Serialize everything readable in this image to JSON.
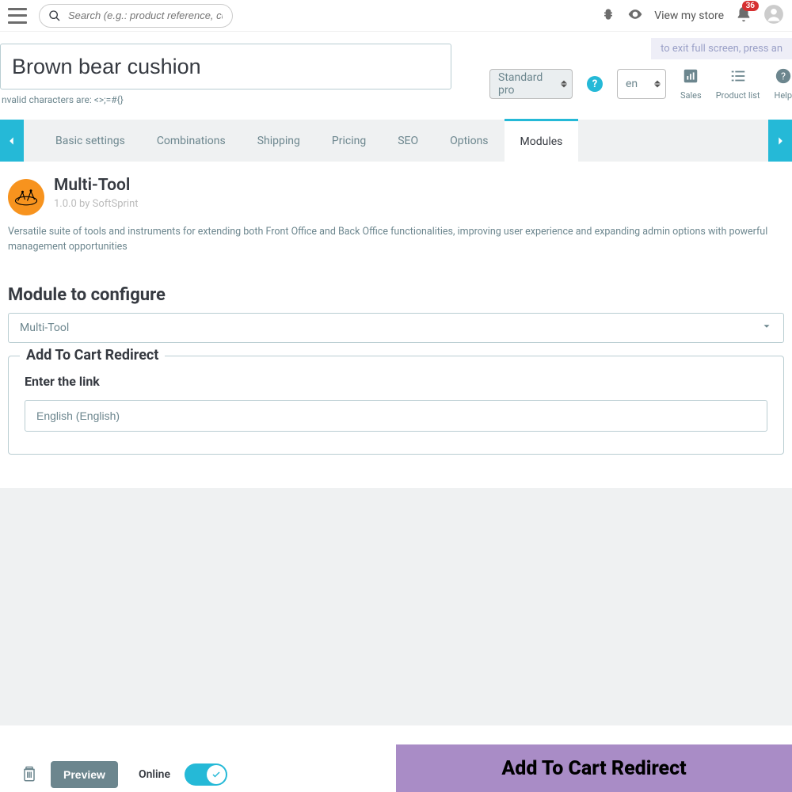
{
  "search": {
    "placeholder": "Search (e.g.: product reference, custom"
  },
  "topbar": {
    "viewstore": "View my store",
    "notif_count": "36"
  },
  "product": {
    "title": "Brown bear cushion",
    "hint": "nvalid characters are: <>;=#{}",
    "type_selected": "Standard pro",
    "lang_selected": "en"
  },
  "stats": {
    "sales": "Sales",
    "product_list": "Product list",
    "help": "Help"
  },
  "tabs": {
    "basic": "Basic settings",
    "combinations": "Combinations",
    "shipping": "Shipping",
    "pricing": "Pricing",
    "seo": "SEO",
    "options": "Options",
    "modules": "Modules"
  },
  "module": {
    "name": "Multi-Tool",
    "subtitle": "1.0.0 by SoftSprint",
    "desc": "Versatile suite of tools and instruments for extending both Front Office and Back Office functionalities, improving user experience and expanding admin options with powerful management opportunities"
  },
  "config": {
    "heading": "Module to configure",
    "selected": "Multi-Tool",
    "fieldset_legend": "Add To Cart Redirect",
    "link_label": "Enter the link",
    "link_value": "English (English)"
  },
  "footer": {
    "preview": "Preview",
    "online": "Online"
  },
  "banner": {
    "text": "Add To Cart Redirect"
  },
  "fullscreen_hint": "to exit full screen, press an"
}
